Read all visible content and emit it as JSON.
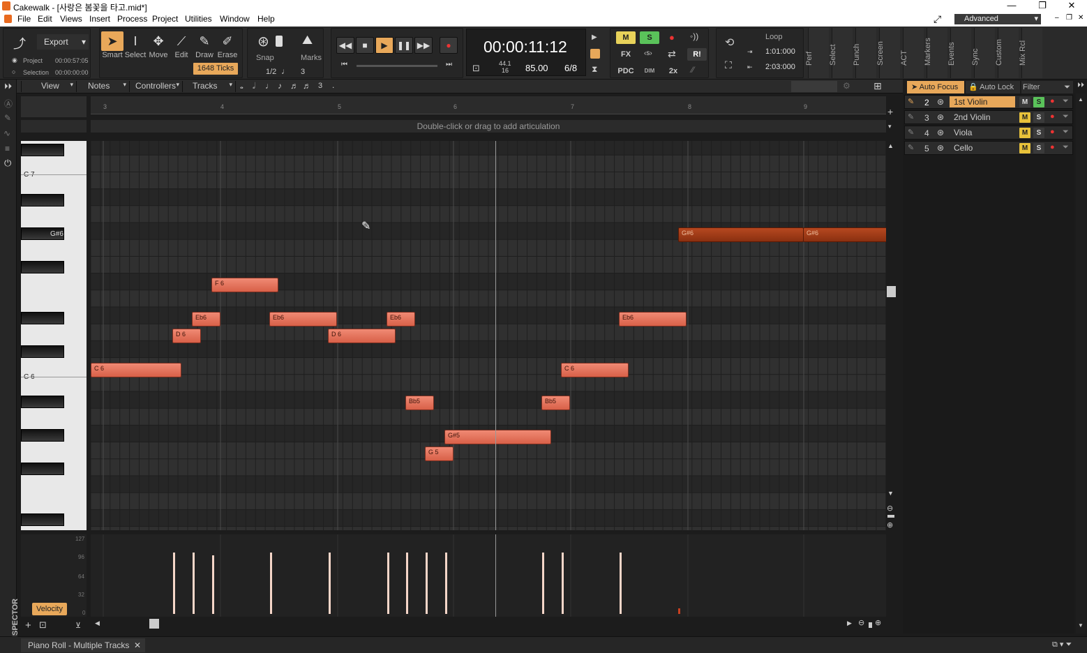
{
  "window": {
    "title": "Cakewalk - [사랑은 봄꽃을 타고.mid*]"
  },
  "menu": [
    "File",
    "Edit",
    "Views",
    "Insert",
    "Process",
    "Project",
    "Utilities",
    "Window",
    "Help"
  ],
  "workspace": "Advanced",
  "export": {
    "label": "Export",
    "project_label": "Project",
    "project_time": "00:00:57:05",
    "selection_label": "Selection",
    "selection_time": "00:00:00:00"
  },
  "tools": [
    "Smart",
    "Select",
    "Move",
    "Edit",
    "Draw",
    "Erase"
  ],
  "snap": {
    "label": "Snap",
    "value": "1648 Ticks",
    "fraction": "1/2",
    "triplet": "3",
    "marks": "Marks"
  },
  "transport": {
    "time": "00:00:11:12",
    "sample_rate": "44.1",
    "bit_depth": "16",
    "tempo": "85.00",
    "meter": "6/8"
  },
  "mix": {
    "m": "M",
    "s": "S",
    "fx": "FX",
    "pdc": "PDC",
    "dim": "DIM",
    "x2": "2x",
    "ri": "R!"
  },
  "loop": {
    "label": "Loop",
    "start": "1:01:000",
    "end": "2:03:000"
  },
  "side_tabs": [
    "Perf",
    "Select",
    "Punch",
    "Screen",
    "ACT",
    "Markers",
    "Events",
    "Sync",
    "Custom",
    "Mix Rcl"
  ],
  "pr_toolbar": {
    "view": "View",
    "notes": "Notes",
    "controllers": "Controllers",
    "tracks": "Tracks",
    "triplet": "3",
    "dot": "."
  },
  "ruler": [
    "3",
    "4",
    "5",
    "6",
    "7",
    "8",
    "9"
  ],
  "articulation_hint": "Double-click or drag to add articulation",
  "keys": {
    "c7": "C 7",
    "gs6": "G#6",
    "c6": "C 6"
  },
  "notes": [
    {
      "label": "C 6"
    },
    {
      "label": "D 6"
    },
    {
      "label": "Eb6"
    },
    {
      "label": "F 6"
    },
    {
      "label": "Eb6"
    },
    {
      "label": "D 6"
    },
    {
      "label": "Eb6"
    },
    {
      "label": "Bb5"
    },
    {
      "label": "G 5"
    },
    {
      "label": "G#5"
    },
    {
      "label": "Bb5"
    },
    {
      "label": "C 6"
    },
    {
      "label": "Eb6"
    },
    {
      "label": "G#6"
    },
    {
      "label": "G#6"
    }
  ],
  "velocity": {
    "label": "Velocity",
    "scale": [
      "127",
      "96",
      "64",
      "32",
      "0"
    ]
  },
  "track_panel": {
    "auto_focus": "Auto Focus",
    "auto_lock": "Auto Lock",
    "filter": "Filter"
  },
  "tracks": [
    {
      "num": "2",
      "name": "1st Violin",
      "m": "M",
      "s": "S",
      "selected": true
    },
    {
      "num": "3",
      "name": "2nd Violin",
      "m": "M",
      "s": "S"
    },
    {
      "num": "4",
      "name": "Viola",
      "m": "M",
      "s": "S"
    },
    {
      "num": "5",
      "name": "Cello",
      "m": "M",
      "s": "S"
    }
  ],
  "status": {
    "tab": "Piano Roll - Multiple Tracks",
    "close": "✕",
    "inspector": "INSPECTOR"
  }
}
